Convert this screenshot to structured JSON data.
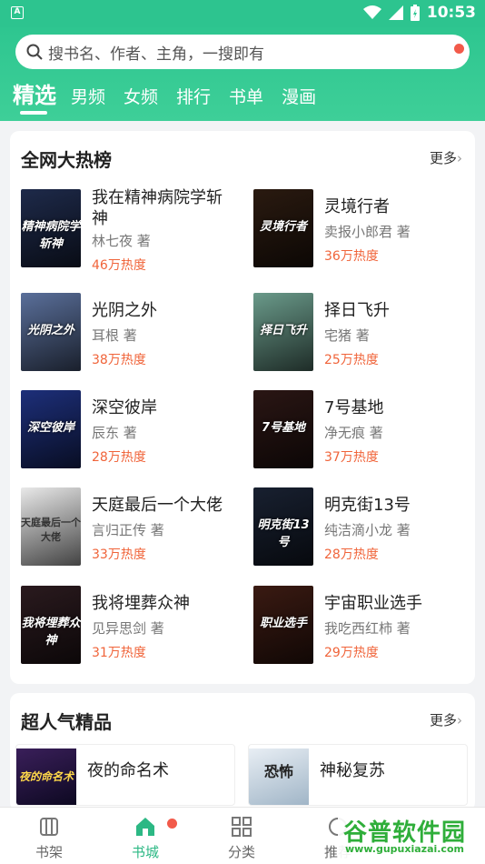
{
  "status_bar": {
    "time": "10:53",
    "app_icon_letter": "A"
  },
  "search": {
    "placeholder": "搜书名、作者、主角，一搜即有"
  },
  "tabs": [
    {
      "label": "精选",
      "active": true
    },
    {
      "label": "男频"
    },
    {
      "label": "女频"
    },
    {
      "label": "排行"
    },
    {
      "label": "书单"
    },
    {
      "label": "漫画"
    }
  ],
  "hot_list": {
    "title": "全网大热榜",
    "more": "更多",
    "books": [
      {
        "title": "我在精神病院学斩神",
        "author": "林七夜 著",
        "heat": "46万热度",
        "cover_text": "精神病院学斩神",
        "cover_color": "#1e2a4a"
      },
      {
        "title": "灵境行者",
        "author": "卖报小郎君 著",
        "heat": "36万热度",
        "cover_text": "灵境行者",
        "cover_color": "#2a1a10"
      },
      {
        "title": "光阴之外",
        "author": "耳根 著",
        "heat": "38万热度",
        "cover_text": "光阴之外",
        "cover_color": "#5a6f9a"
      },
      {
        "title": "择日飞升",
        "author": "宅猪 著",
        "heat": "25万热度",
        "cover_text": "择日飞升",
        "cover_color": "#6a9a8a"
      },
      {
        "title": "深空彼岸",
        "author": "辰东 著",
        "heat": "28万热度",
        "cover_text": "深空彼岸",
        "cover_color": "#1d2f7a"
      },
      {
        "title": "7号基地",
        "author": "净无痕 著",
        "heat": "37万热度",
        "cover_text": "7号基地",
        "cover_color": "#2a1614"
      },
      {
        "title": "天庭最后一个大佬",
        "author": "言归正传 著",
        "heat": "33万热度",
        "cover_text": "天庭最后一个 大佬",
        "cover_color": "#e9e9e9"
      },
      {
        "title": "明克街13号",
        "author": "纯洁滴小龙 著",
        "heat": "28万热度",
        "cover_text": "明克街13号",
        "cover_color": "#182030"
      },
      {
        "title": "我将埋葬众神",
        "author": "见异思剑 著",
        "heat": "31万热度",
        "cover_text": "我将埋葬众神",
        "cover_color": "#2a1a1e"
      },
      {
        "title": "宇宙职业选手",
        "author": "我吃西红柿 著",
        "heat": "29万热度",
        "cover_text": "职业选手",
        "cover_color": "#3a1a12"
      }
    ]
  },
  "popular": {
    "title": "超人气精品",
    "more": "更多",
    "books": [
      {
        "title": "夜的命名术",
        "cover_text": "夜的命名术",
        "cover_color": "#3a1f5a"
      },
      {
        "title": "神秘复苏",
        "cover_text": "恐怖",
        "cover_color": "#e8eef4"
      }
    ]
  },
  "bottom_nav": [
    {
      "label": "书架",
      "icon": "bookshelf-icon"
    },
    {
      "label": "书城",
      "icon": "bookstore-home-icon",
      "active": true
    },
    {
      "label": "分类",
      "icon": "category-grid-icon"
    },
    {
      "label": "推荐",
      "icon": "recommend-icon"
    }
  ],
  "watermark": {
    "text": "谷普软件园",
    "url": "www.gupuxiazai.com"
  },
  "colors": {
    "brand": "#2dc48f",
    "heat": "#f0643a",
    "badge": "#f25a4a"
  }
}
